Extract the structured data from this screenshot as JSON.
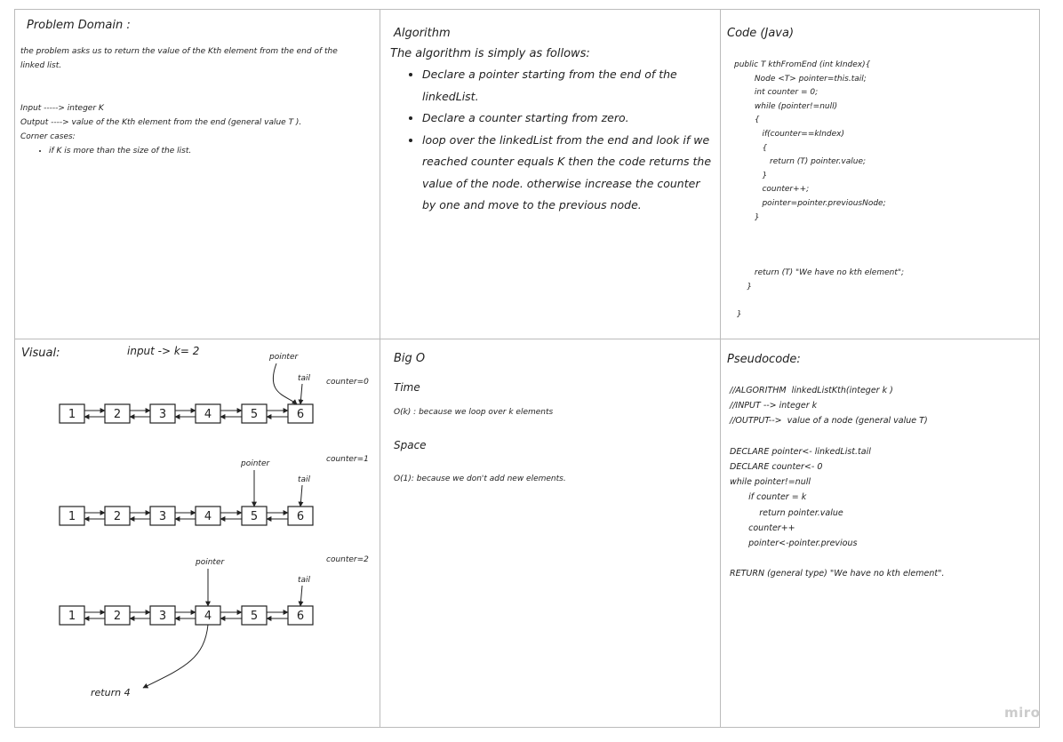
{
  "problem": {
    "title": "Problem Domain :",
    "lines": [
      "the problem asks us to return the value of the Kth element from the end of the",
      "linked list.",
      "",
      "",
      "Input -----> integer K",
      "Output ----> value of the Kth element from the end (general value T ).",
      "Corner cases:"
    ],
    "bullets": [
      "if K is more than the size of the list."
    ]
  },
  "algorithm": {
    "title": "Algorithm",
    "intro": "The algorithm is simply as follows:",
    "bullets": [
      "Declare a pointer starting from the end of the linkedList.",
      "Declare a counter starting from zero.",
      "loop over the linkedList from the end and look if we reached counter equals K then the code returns the value of the node. otherwise increase the counter by one and move to the previous node."
    ]
  },
  "code": {
    "title": "Code (Java)",
    "lines": [
      "public T kthFromEnd (int kIndex){",
      "        Node <T> pointer=this.tail;",
      "        int counter = 0;",
      "        while (pointer!=null)",
      "        {",
      "           if(counter==kIndex)",
      "           {",
      "              return (T) pointer.value;",
      "           }",
      "           counter++;",
      "           pointer=pointer.previousNode;",
      "        }",
      "",
      "",
      "",
      "        return (T) \"We have no kth element\";",
      "     }",
      "",
      " }"
    ]
  },
  "visual": {
    "title": "Visual:",
    "input_label": "input -> k= 2",
    "nodes": [
      "1",
      "2",
      "3",
      "4",
      "5",
      "6"
    ],
    "steps": [
      {
        "counter": "counter=0",
        "pointer_label": "pointer",
        "tail_label": "tail",
        "pointer_at": 6
      },
      {
        "counter": "counter=1",
        "pointer_label": "pointer",
        "tail_label": "tail",
        "pointer_at": 5
      },
      {
        "counter": "counter=2",
        "pointer_label": "pointer",
        "tail_label": "tail",
        "pointer_at": 4
      }
    ],
    "result": "return 4"
  },
  "bigo": {
    "title": "Big O",
    "time_title": "Time",
    "time_text": "O(k) : because we loop over k elements",
    "space_title": "Space",
    "space_text": "O(1): because we don't add new elements."
  },
  "pseudocode": {
    "title": "Pseudocode:",
    "lines": [
      "//ALGORITHM  linkedListKth(integer k )",
      "//INPUT --> integer k",
      "//OUTPUT-->  value of a node (general value T)",
      "",
      "DECLARE pointer<- linkedList.tail",
      "DECLARE counter<- 0",
      "while pointer!=null",
      "       if counter = k",
      "           return pointer.value",
      "       counter++",
      "       pointer<-pointer.previous",
      "",
      "RETURN (general type) \"We have no kth element\"."
    ]
  },
  "branding": {
    "logo": "miro"
  }
}
